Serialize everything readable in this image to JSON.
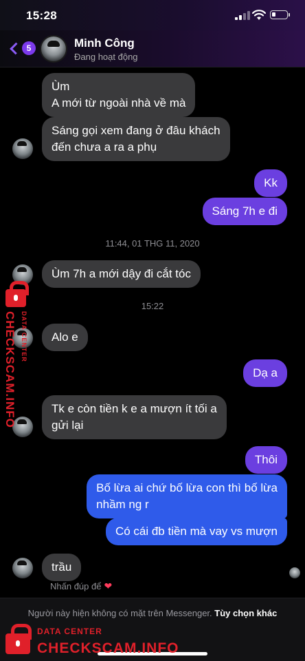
{
  "status_bar": {
    "time": "15:28",
    "battery_level": 0.25
  },
  "header": {
    "back_badge": "5",
    "contact_name": "Minh Công",
    "contact_status": "Đang hoạt động"
  },
  "messages": [
    {
      "sender": "them",
      "text_lines": [
        "Ùm",
        "A mới từ ngoài nhà về mà"
      ]
    },
    {
      "sender": "them",
      "text_lines": [
        "Sáng gọi xem đang ở đâu khách",
        "đến chưa a ra a phụ"
      ]
    },
    {
      "sender": "me",
      "text_lines": [
        "Kk"
      ]
    },
    {
      "sender": "me",
      "text_lines": [
        "Sáng 7h e đi"
      ]
    },
    {
      "type": "timestamp",
      "text": "11:44, 01 THG 11, 2020"
    },
    {
      "sender": "them",
      "text_lines": [
        "Ùm 7h a mới dậy đi cắt tóc"
      ]
    },
    {
      "type": "timestamp",
      "text": "15:22"
    },
    {
      "sender": "them",
      "text_lines": [
        "Alo e"
      ]
    },
    {
      "sender": "me",
      "text_lines": [
        "Dạ a"
      ]
    },
    {
      "sender": "them",
      "text_lines": [
        "Tk e còn tiền k e a mượn ít tối a",
        "gửi lại"
      ]
    },
    {
      "sender": "me",
      "text_lines": [
        "Thôi"
      ]
    },
    {
      "sender": "me",
      "text_lines": [
        "Bố lừa ai chứ bố lừa con thì bố lừa",
        "nhầm ng r"
      ]
    },
    {
      "sender": "me",
      "text_lines": [
        "Có cái đb tiền mà vay vs mượn"
      ]
    },
    {
      "sender": "them",
      "text_lines": [
        "trầu"
      ]
    }
  ],
  "double_tap_hint": "Nhấn đúp để",
  "footer": {
    "notice": "Người này hiện không có mặt trên Messenger.",
    "link": "Tùy chọn khác"
  },
  "watermark": {
    "small": "DATA CENTER",
    "big": "CHECKSCAM.INFO"
  },
  "colors": {
    "incoming_bubble": "#3a3a3c",
    "outgoing_purple": "#6b3fe0",
    "outgoing_blue": "#2f5bea",
    "accent": "#8b5cf6",
    "watermark": "#e0202a"
  },
  "icons": [
    "back-chevron-icon",
    "signal-icon",
    "wifi-icon",
    "battery-icon",
    "heart-icon",
    "lock-icon"
  ]
}
